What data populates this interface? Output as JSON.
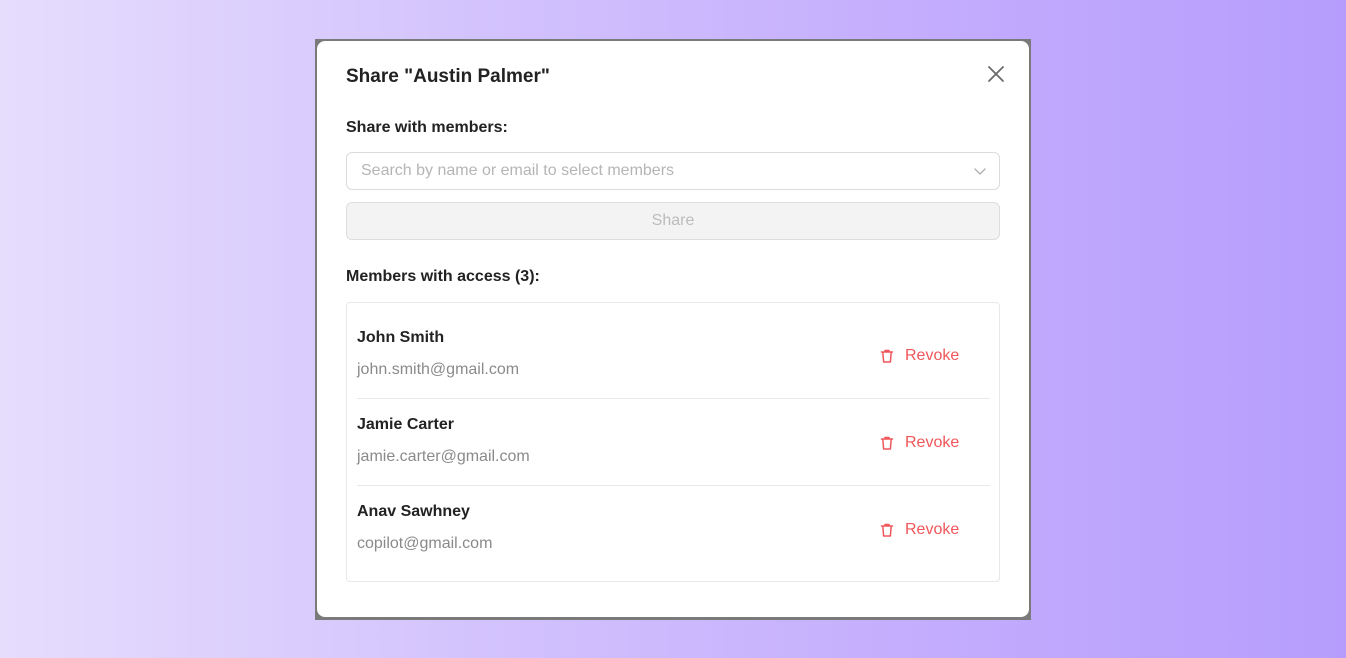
{
  "dialog": {
    "title": "Share \"Austin Palmer\"",
    "share_label": "Share with members:",
    "search_placeholder": "Search by name or email to select members",
    "share_button": "Share",
    "members_label": "Members with access (3):"
  },
  "members": [
    {
      "name": "John Smith",
      "email": "john.smith@gmail.com",
      "action": "Revoke"
    },
    {
      "name": "Jamie Carter",
      "email": "jamie.carter@gmail.com",
      "action": "Revoke"
    },
    {
      "name": "Anav Sawhney",
      "email": "copilot@gmail.com",
      "action": "Revoke"
    }
  ],
  "icons": {
    "close": "close-icon",
    "dropdown": "chevron-down-icon",
    "revoke": "trash-icon"
  },
  "colors": {
    "danger": "#f0565a",
    "disabled_text": "#bcbcbc"
  }
}
